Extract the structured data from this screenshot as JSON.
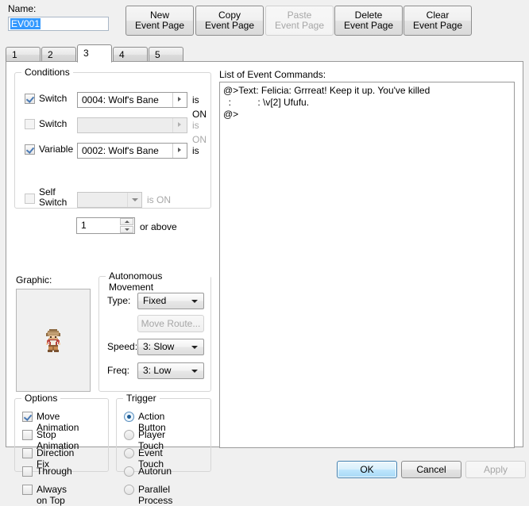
{
  "window": {
    "name_label": "Name:",
    "name_value": "EV001"
  },
  "toolbar": {
    "new_line1": "New",
    "new_line2": "Event Page",
    "copy_line1": "Copy",
    "copy_line2": "Event Page",
    "paste_line1": "Paste",
    "paste_line2": "Event Page",
    "delete_line1": "Delete",
    "delete_line2": "Event Page",
    "clear_line1": "Clear",
    "clear_line2": "Event Page"
  },
  "tabs": [
    {
      "label": "1",
      "active": false
    },
    {
      "label": "2",
      "active": false
    },
    {
      "label": "3",
      "active": true
    },
    {
      "label": "4",
      "active": false
    },
    {
      "label": "5",
      "active": false
    }
  ],
  "conditions": {
    "title": "Conditions",
    "switch1": {
      "label": "Switch",
      "value": "0004: Wolf's Bane",
      "suffix": "is ON",
      "checked": true,
      "enabled": true
    },
    "switch2": {
      "label": "Switch",
      "value": "",
      "suffix": "is ON",
      "checked": false,
      "enabled": false
    },
    "variable": {
      "label": "Variable",
      "value": "0002: Wolf's Bane",
      "suffix": "is",
      "checked": true,
      "enabled": true,
      "amount": "1",
      "amount_suffix": "or above"
    },
    "self_switch": {
      "label_line1": "Self",
      "label_line2": "Switch",
      "value": "",
      "suffix": "is ON",
      "checked": false,
      "enabled": false
    }
  },
  "graphic": {
    "label": "Graphic:"
  },
  "movement": {
    "title": "Autonomous Movement",
    "type_label": "Type:",
    "type_value": "Fixed",
    "move_route_label": "Move Route...",
    "speed_label": "Speed:",
    "speed_value": "3: Slow",
    "freq_label": "Freq:",
    "freq_value": "3: Low"
  },
  "options": {
    "title": "Options",
    "items": [
      {
        "label": "Move Animation",
        "checked": true
      },
      {
        "label": "Stop Animation",
        "checked": false
      },
      {
        "label": "Direction Fix",
        "checked": false
      },
      {
        "label": "Through",
        "checked": false
      },
      {
        "label": "Always on Top",
        "checked": false
      }
    ]
  },
  "trigger": {
    "title": "Trigger",
    "items": [
      {
        "label": "Action Button",
        "selected": true
      },
      {
        "label": "Player Touch",
        "selected": false
      },
      {
        "label": "Event Touch",
        "selected": false
      },
      {
        "label": "Autorun",
        "selected": false
      },
      {
        "label": "Parallel Process",
        "selected": false
      }
    ]
  },
  "commands": {
    "label": "List of Event Commands:",
    "text": "@>Text: Felicia: Grrreat! Keep it up. You've killed\n  :          : \\v[2] Ufufu.\n@>"
  },
  "footer": {
    "ok": "OK",
    "cancel": "Cancel",
    "apply": "Apply"
  },
  "colors": {
    "accent": "#3399ff",
    "ok_border": "#3c7fb1",
    "panel_bg": "#ffffff",
    "dialog_bg": "#f0f0f0"
  }
}
